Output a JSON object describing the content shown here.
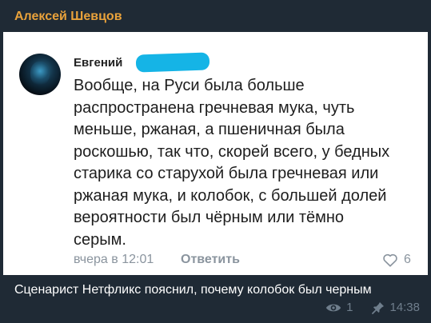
{
  "channel": {
    "author_name": "Алексей Шевцов"
  },
  "comment": {
    "author_first_name": "Евгений",
    "text": "Вообще, на Руси была больше\nраспространена гречневая мука, чуть\nменьше, ржаная, а пшеничная была\nроскошью, так что, скорей всего, у бедных\nстарика со старухой была гречневая или\nржаная мука, и колобок, с большей долей\nвероятности был чёрным или тёмно\nсерым.",
    "time": "вчера в 12:01",
    "reply_label": "Ответить",
    "likes": "6",
    "redaction_color": "#15b4e6"
  },
  "post": {
    "caption": "Сценарист Нетфликс пояснил, почему колобок был черным",
    "views": "1",
    "time": "14:38"
  },
  "colors": {
    "author_accent": "#e9a23b",
    "background": "#1f2a35",
    "card": "#ffffff",
    "muted_text": "#8a949e"
  },
  "icons": {
    "like": "heart-icon",
    "views": "eye-icon",
    "pinned": "pin-icon"
  }
}
